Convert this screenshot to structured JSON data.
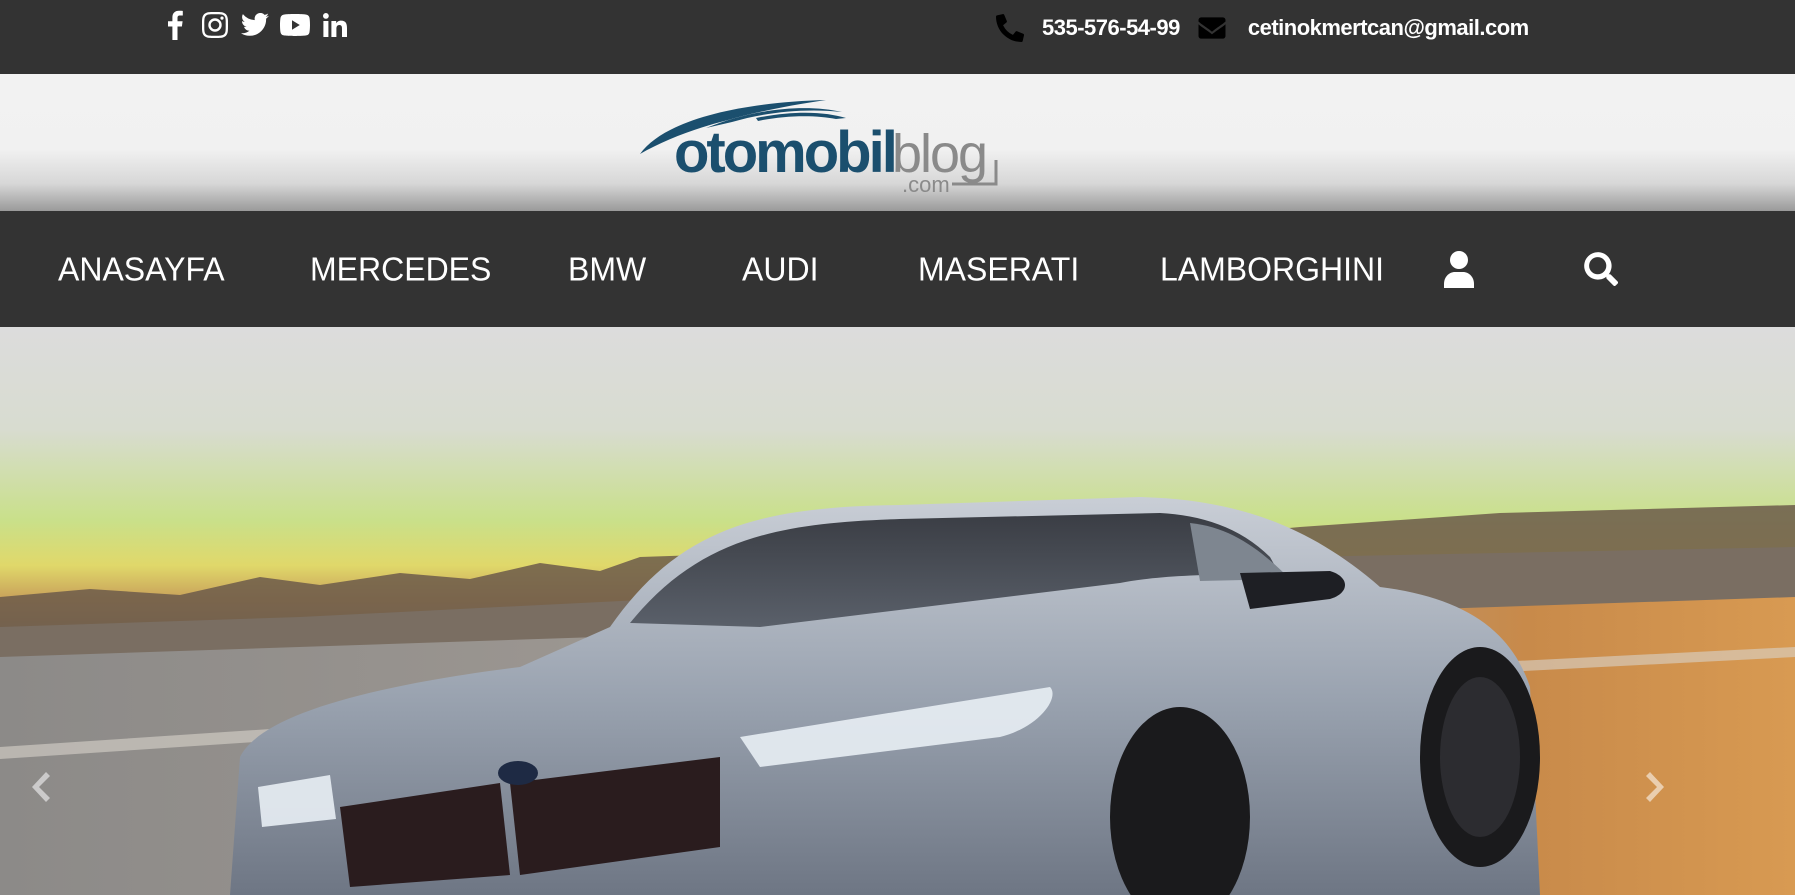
{
  "topbar": {
    "social_icons": [
      "facebook-icon",
      "instagram-icon",
      "twitter-icon",
      "youtube-icon",
      "linkedin-icon"
    ],
    "phone": "535-576-54-99",
    "email": "cetinokmertcan@gmail.com"
  },
  "logo": {
    "text_main": "otomobil",
    "text_secondary": "blog",
    "suffix": ".com"
  },
  "nav": {
    "items": [
      {
        "label": "ANASAYFA"
      },
      {
        "label": "MERCEDES"
      },
      {
        "label": "BMW"
      },
      {
        "label": "AUDI"
      },
      {
        "label": "MASERATI"
      },
      {
        "label": "LAMBORGHINI"
      }
    ],
    "icons": [
      "user-icon",
      "search-icon"
    ]
  },
  "hero": {
    "arrows": [
      "chevron-left-icon",
      "chevron-right-icon"
    ]
  },
  "colors": {
    "bar": "#333333",
    "logo_blue": "#1b4f6e",
    "logo_gray": "#8a8a8a"
  }
}
